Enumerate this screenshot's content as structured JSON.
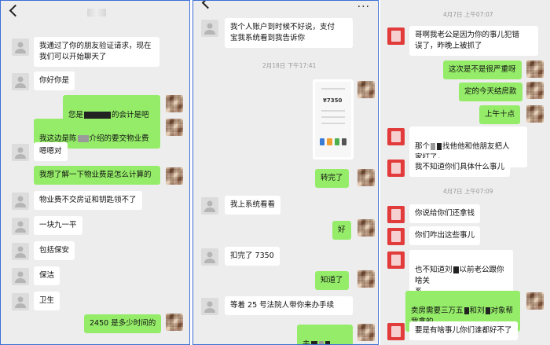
{
  "colors": {
    "bubble_sent": "#95ec69",
    "bubble_received": "#ffffff",
    "chat_bg": "#ededed",
    "frame": "#3b6fd6"
  },
  "icons": {
    "back": "chevron-left-icon",
    "more": "more-dots-icon"
  },
  "panel1": {
    "messages": [
      {
        "text": "我通过了你的朋友验证请求，现在\n我们可以开始聊天了"
      },
      {
        "text": "你好你是"
      },
      {
        "a": "您是",
        "b": "的会计是吧"
      },
      {
        "a": "我这边是陈",
        "b": "介绍的要交物业费"
      },
      {
        "text": "嗯嗯对"
      },
      {
        "text": "我想了解一下物业费是怎么计算的"
      },
      {
        "text": "物业费不交房证和钥匙领不了"
      },
      {
        "text": "一块九一平"
      },
      {
        "text": "包括保安"
      },
      {
        "text": "保洁"
      },
      {
        "text": "卫生"
      },
      {
        "text": "2450 是多少时间的"
      }
    ]
  },
  "panel2": {
    "more": "···",
    "timestamp": "2月18日 下午17:41",
    "image_amount": "¥7350",
    "messages": [
      {
        "text": "我个人账户到时候不好说，支付\n宝我系统看到我告诉你"
      },
      {
        "text": "转完了"
      },
      {
        "text": "我上系统看看"
      },
      {
        "text": "好"
      },
      {
        "text": "扣完了 7350"
      },
      {
        "text": "知道了"
      },
      {
        "text": "等着 25 号法院人带你来办手续"
      },
      {
        "text": "去"
      }
    ]
  },
  "panel3": {
    "timestamp1": "4月7日 上午07:07",
    "timestamp2": "4月7日 上午07:09",
    "messages": [
      {
        "text": "哥啊我老公是因为你的事儿犯错\n误了，昨晚上被抓了"
      },
      {
        "text": "这次是不是很严重呀"
      },
      {
        "text": "定的今天结房款"
      },
      {
        "text": "上午十点"
      },
      {
        "a": "那个",
        "b": "找他他和他朋友把人\n家打了，"
      },
      {
        "text": "我不知道你们具体什么事儿"
      },
      {
        "text": "你说给你们还拿钱"
      },
      {
        "text": "你们咋出这些事儿"
      },
      {
        "a": "也不知道刘",
        "b": "以前老公跟你啥关\n系\n这家伙把我老公逼的"
      },
      {
        "a": "卖房需要三万五",
        "b": "和刘",
        "c": "对象帮\n我拿的"
      },
      {
        "text": "要是有啥事儿你们谁都好不了"
      }
    ]
  }
}
